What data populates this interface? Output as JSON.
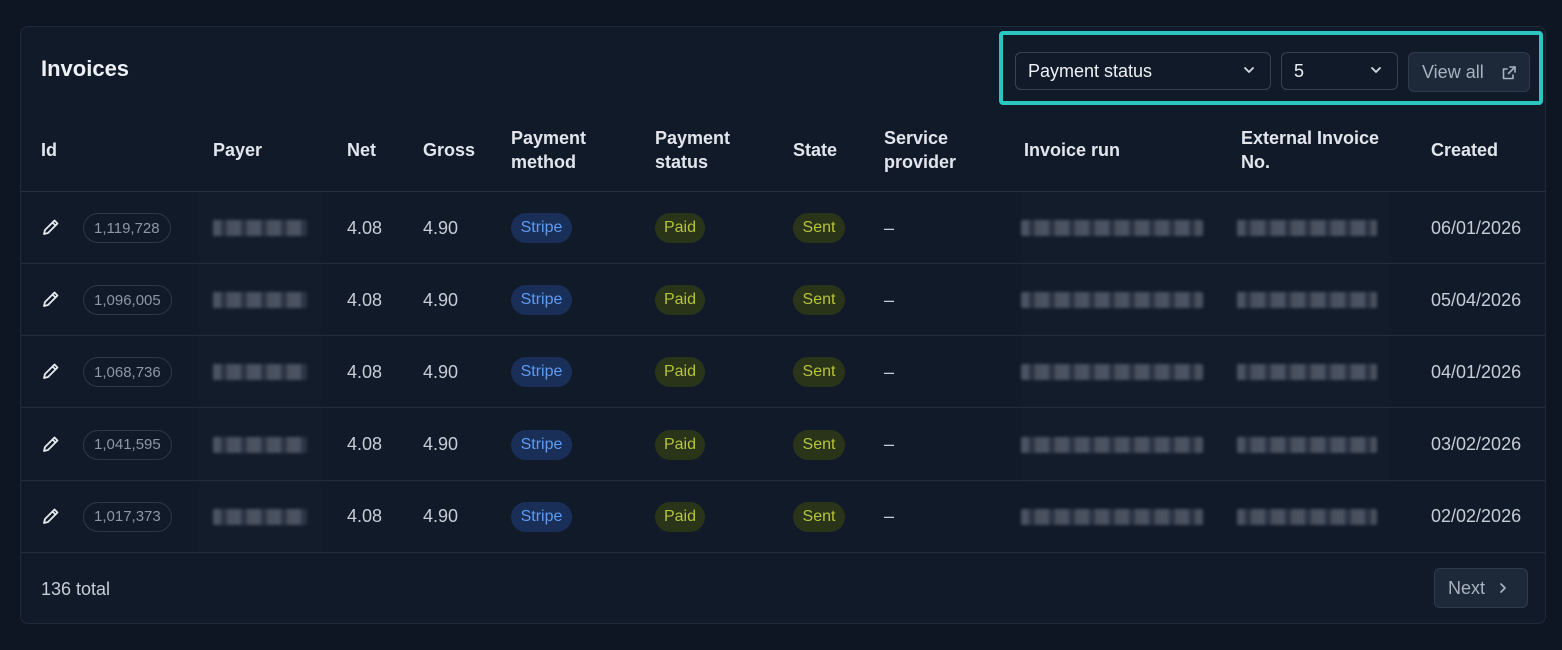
{
  "card": {
    "title": "Invoices"
  },
  "toolbar": {
    "status_filter": {
      "value": "Payment status",
      "icon": "chevron-down-icon"
    },
    "page_size": {
      "value": "5",
      "icon": "chevron-down-icon"
    },
    "view_all_label": "View all",
    "view_all_icon": "external-link-icon",
    "highlight_color": "#2ec4bf"
  },
  "table": {
    "columns": [
      {
        "key": "id",
        "label": "Id"
      },
      {
        "key": "payer",
        "label": "Payer"
      },
      {
        "key": "net",
        "label": "Net"
      },
      {
        "key": "gross",
        "label": "Gross"
      },
      {
        "key": "payment_method",
        "label_lines": [
          "Payment",
          "method"
        ]
      },
      {
        "key": "payment_status",
        "label_lines": [
          "Payment",
          "status"
        ]
      },
      {
        "key": "state",
        "label": "State"
      },
      {
        "key": "service_provider",
        "label_lines": [
          "Service",
          "provider"
        ]
      },
      {
        "key": "invoice_run",
        "label": "Invoice run"
      },
      {
        "key": "external_invoice_no",
        "label_lines": [
          "External Invoice",
          "No."
        ]
      },
      {
        "key": "created",
        "label": "Created"
      }
    ],
    "rows": [
      {
        "id": "1,119,728",
        "net": "4.08",
        "gross": "4.90",
        "payment_method": "Stripe",
        "payment_status": "Paid",
        "state": "Sent",
        "service_provider": "–",
        "created": "06/01/2026"
      },
      {
        "id": "1,096,005",
        "net": "4.08",
        "gross": "4.90",
        "payment_method": "Stripe",
        "payment_status": "Paid",
        "state": "Sent",
        "service_provider": "–",
        "created": "05/04/2026"
      },
      {
        "id": "1,068,736",
        "net": "4.08",
        "gross": "4.90",
        "payment_method": "Stripe",
        "payment_status": "Paid",
        "state": "Sent",
        "service_provider": "–",
        "created": "04/01/2026"
      },
      {
        "id": "1,041,595",
        "net": "4.08",
        "gross": "4.90",
        "payment_method": "Stripe",
        "payment_status": "Paid",
        "state": "Sent",
        "service_provider": "–",
        "created": "03/02/2026"
      },
      {
        "id": "1,017,373",
        "net": "4.08",
        "gross": "4.90",
        "payment_method": "Stripe",
        "payment_status": "Paid",
        "state": "Sent",
        "service_provider": "–",
        "created": "02/02/2026"
      }
    ],
    "row_edit_icon": "pencil-icon",
    "colors": {
      "stripe_text": "#5b9cf5",
      "stripe_bg": "#1a2f57",
      "paid_sent_text": "#b6c53a",
      "paid_sent_bg": "#2a3419"
    }
  },
  "footer": {
    "total_label": "136 total",
    "next_label": "Next",
    "next_icon": "chevron-right-icon"
  }
}
